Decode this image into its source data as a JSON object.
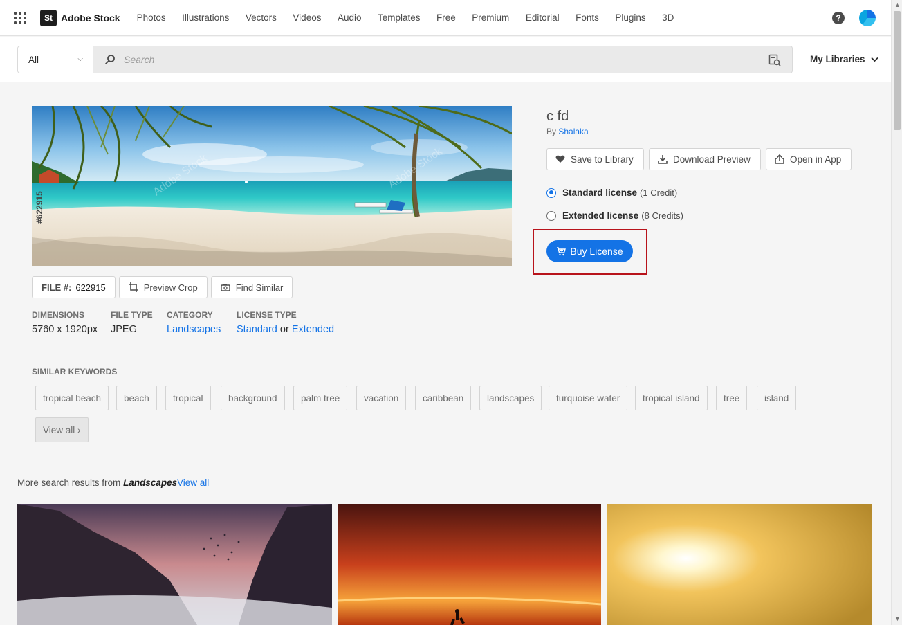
{
  "brand": {
    "logo_mark": "St",
    "name": "Adobe Stock"
  },
  "nav": {
    "links": [
      "Photos",
      "Illustrations",
      "Vectors",
      "Videos",
      "Audio",
      "Templates",
      "Free",
      "Premium",
      "Editorial",
      "Fonts",
      "Plugins",
      "3D"
    ],
    "help_icon": "?"
  },
  "search": {
    "filter_value": "All",
    "placeholder": "Search",
    "my_libraries": "My Libraries"
  },
  "asset": {
    "watermark_id": "#622915",
    "title": "c fd",
    "by_prefix": "By",
    "author": "Shalaka",
    "file_label": "FILE #:",
    "file_number": "622915",
    "preview_crop": "Preview Crop",
    "find_similar": "Find Similar",
    "dimensions_label": "DIMENSIONS",
    "dimensions_value": "5760 x 1920px",
    "filetype_label": "FILE TYPE",
    "filetype_value": "JPEG",
    "category_label": "CATEGORY",
    "category_value": "Landscapes",
    "license_label": "LICENSE TYPE",
    "license_standard": "Standard",
    "license_or": "or",
    "license_extended": "Extended"
  },
  "actions": {
    "save": "Save to Library",
    "download": "Download Preview",
    "open": "Open in App"
  },
  "licenses": {
    "standard_name": "Standard license",
    "standard_credits": "(1 Credit)",
    "extended_name": "Extended license",
    "extended_credits": "(8 Credits)",
    "selected": "standard",
    "buy_label": "Buy License"
  },
  "keywords": {
    "label": "SIMILAR KEYWORDS",
    "items": [
      "tropical beach",
      "beach",
      "tropical",
      "background",
      "palm tree",
      "vacation",
      "caribbean",
      "landscapes",
      "turquoise water",
      "tropical island",
      "tree",
      "island"
    ],
    "view_all": "View all ›"
  },
  "more_results": {
    "prefix": "More search results from",
    "category": "Landscapes",
    "view_all": "View all"
  },
  "colors": {
    "accent": "#1473e6",
    "highlight_outline": "#b8131b"
  }
}
